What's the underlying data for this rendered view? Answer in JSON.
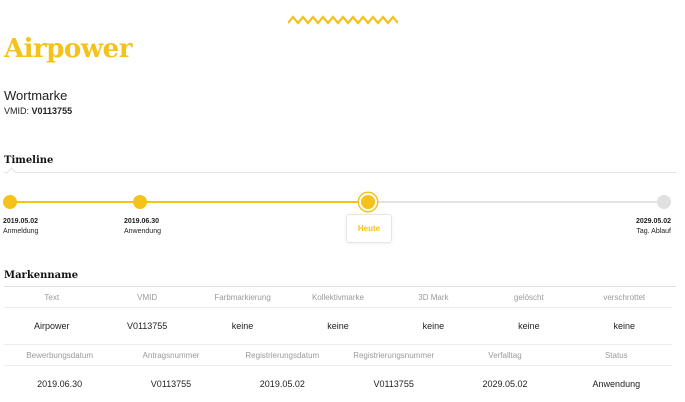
{
  "header": {
    "brand": "Airpower",
    "mark_type": "Wortmarke",
    "vmid_label": "VMID:",
    "vmid_value": "V0113755",
    "accent_color": "#f4c21b"
  },
  "timeline": {
    "title": "Timeline",
    "events": [
      {
        "date": "2019.05.02",
        "label": "Anmeldung"
      },
      {
        "date": "2019.06.30",
        "label": "Anwendung"
      },
      {
        "date": "2029.05.02",
        "label": "Tag. Ablauf"
      }
    ],
    "today_label": "Heute"
  },
  "markenname": {
    "title": "Markenname",
    "table1": {
      "headers": [
        "Text",
        "VMID",
        "Farbmarkierung",
        "Kollektivmarke",
        "3D Mark",
        "gelöscht",
        "verschrottet"
      ],
      "values": [
        "Airpower",
        "V0113755",
        "keine",
        "keine",
        "keine",
        "keine",
        "keine"
      ]
    },
    "table2": {
      "headers": [
        "Bewerbungsdatum",
        "Antragsnummer",
        "Registrierungsdatum",
        "Registrierungsnummer",
        "Verfalltag",
        "Status"
      ],
      "values": [
        "2019.06.30",
        "V0113755",
        "2019.05.02",
        "V0113755",
        "2029.05.02",
        "Anwendung"
      ]
    }
  }
}
